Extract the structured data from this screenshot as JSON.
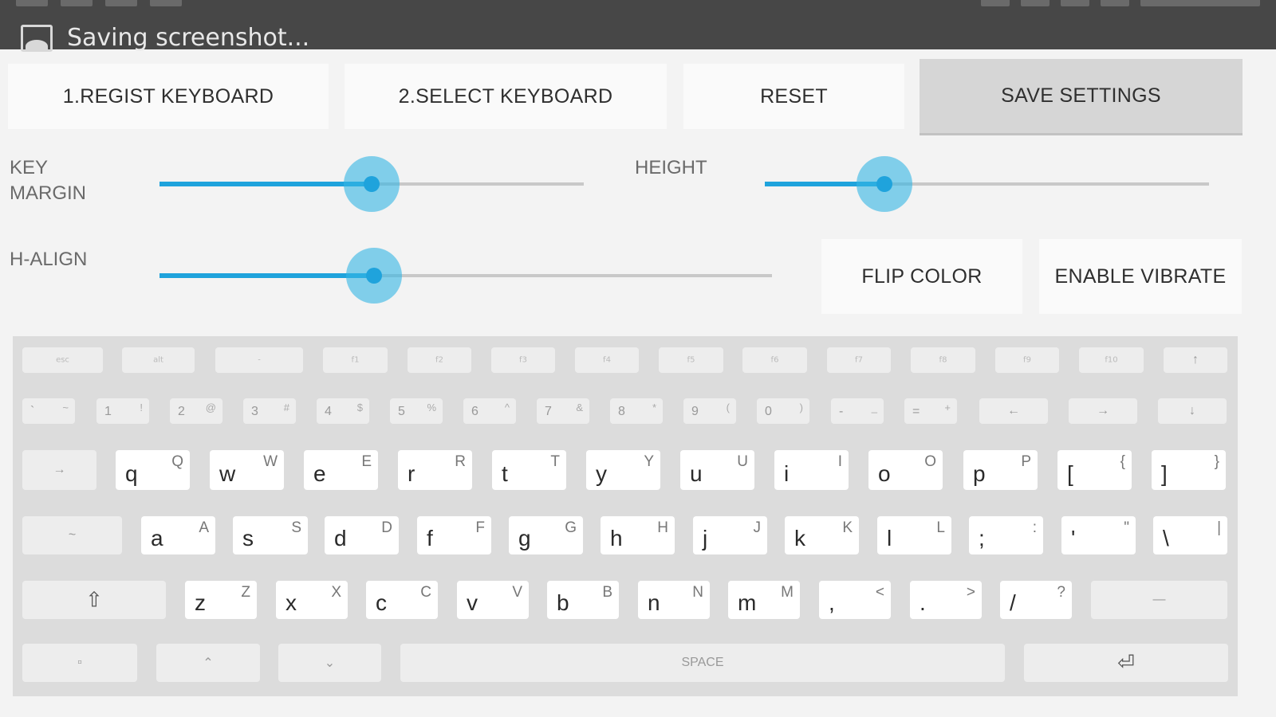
{
  "status_bar": {
    "notification_text": "Saving screenshot...",
    "notification_icon": "picture-icon"
  },
  "buttons": {
    "regist_keyboard": "1.REGIST KEYBOARD",
    "select_keyboard": "2.SELECT KEYBOARD",
    "reset": "RESET",
    "save_settings": "SAVE SETTINGS",
    "flip_color": "FLIP COLOR",
    "enable_vibrate": "ENABLE VIBRATE"
  },
  "settings": {
    "key_margin": {
      "label": "KEY\nMARGIN",
      "value": 0.5
    },
    "height": {
      "label": "HEIGHT",
      "value": 0.27
    },
    "h_align": {
      "label": "H-ALIGN",
      "value": 0.35
    }
  },
  "colors": {
    "accent": "#33b5e5",
    "pressed_button": "#d6d6d6",
    "keyboard_bg": "#dcdcdc"
  },
  "keyboard": {
    "rows": [
      [
        {
          "small": "esc"
        },
        {
          "small": "alt"
        },
        {
          "small": "-"
        },
        {
          "small": "f1"
        },
        {
          "small": "f2"
        },
        {
          "small": "f3"
        },
        {
          "small": "f4"
        },
        {
          "small": "f5"
        },
        {
          "small": "f6"
        },
        {
          "small": "f7"
        },
        {
          "small": "f8"
        },
        {
          "small": "f9"
        },
        {
          "small": "f10"
        },
        {
          "center": "↑"
        }
      ],
      [
        {
          "main": "`",
          "shift": "~",
          "style": "num"
        },
        {
          "main": "1",
          "shift": "!",
          "style": "num"
        },
        {
          "main": "2",
          "shift": "@",
          "style": "num"
        },
        {
          "main": "3",
          "shift": "#",
          "style": "num"
        },
        {
          "main": "4",
          "shift": "$",
          "style": "num"
        },
        {
          "main": "5",
          "shift": "%",
          "style": "num"
        },
        {
          "main": "6",
          "shift": "^",
          "style": "num"
        },
        {
          "main": "7",
          "shift": "&",
          "style": "num"
        },
        {
          "main": "8",
          "shift": "*",
          "style": "num"
        },
        {
          "main": "9",
          "shift": "(",
          "style": "num"
        },
        {
          "main": "0",
          "shift": ")",
          "style": "num"
        },
        {
          "main": "-",
          "shift": "_",
          "style": "num"
        },
        {
          "main": "=",
          "shift": "+",
          "style": "num"
        },
        {
          "center": "←"
        },
        {
          "center": "→"
        },
        {
          "center": "↓"
        }
      ],
      [
        {
          "center": "→"
        },
        {
          "main": "q",
          "shift": "Q"
        },
        {
          "main": "w",
          "shift": "W"
        },
        {
          "main": "e",
          "shift": "E"
        },
        {
          "main": "r",
          "shift": "R"
        },
        {
          "main": "t",
          "shift": "T"
        },
        {
          "main": "y",
          "shift": "Y"
        },
        {
          "main": "u",
          "shift": "U"
        },
        {
          "main": "i",
          "shift": "I"
        },
        {
          "main": "o",
          "shift": "O"
        },
        {
          "main": "p",
          "shift": "P"
        },
        {
          "main": "[",
          "shift": "{"
        },
        {
          "main": "]",
          "shift": "}"
        }
      ],
      [
        {
          "center": "~"
        },
        {
          "main": "a",
          "shift": "A"
        },
        {
          "main": "s",
          "shift": "S"
        },
        {
          "main": "d",
          "shift": "D"
        },
        {
          "main": "f",
          "shift": "F"
        },
        {
          "main": "g",
          "shift": "G"
        },
        {
          "main": "h",
          "shift": "H"
        },
        {
          "main": "j",
          "shift": "J"
        },
        {
          "main": "k",
          "shift": "K"
        },
        {
          "main": "l",
          "shift": "L"
        },
        {
          "main": ";",
          "shift": ":"
        },
        {
          "main": "'",
          "shift": "\""
        },
        {
          "main": "\\",
          "shift": "|"
        }
      ],
      [
        {
          "center": "⇧",
          "big": true
        },
        {
          "main": "z",
          "shift": "Z"
        },
        {
          "main": "x",
          "shift": "X"
        },
        {
          "main": "c",
          "shift": "C"
        },
        {
          "main": "v",
          "shift": "V"
        },
        {
          "main": "b",
          "shift": "B"
        },
        {
          "main": "n",
          "shift": "N"
        },
        {
          "main": "m",
          "shift": "M"
        },
        {
          "main": ",",
          "shift": "<"
        },
        {
          "main": ".",
          "shift": ">"
        },
        {
          "main": "/",
          "shift": "?"
        },
        {
          "center": "—"
        }
      ],
      [
        {
          "center": "▫"
        },
        {
          "center": "⌃"
        },
        {
          "center": "⌄"
        },
        {
          "center": "SPACE"
        },
        {
          "center": "⏎",
          "big": true
        }
      ]
    ]
  }
}
